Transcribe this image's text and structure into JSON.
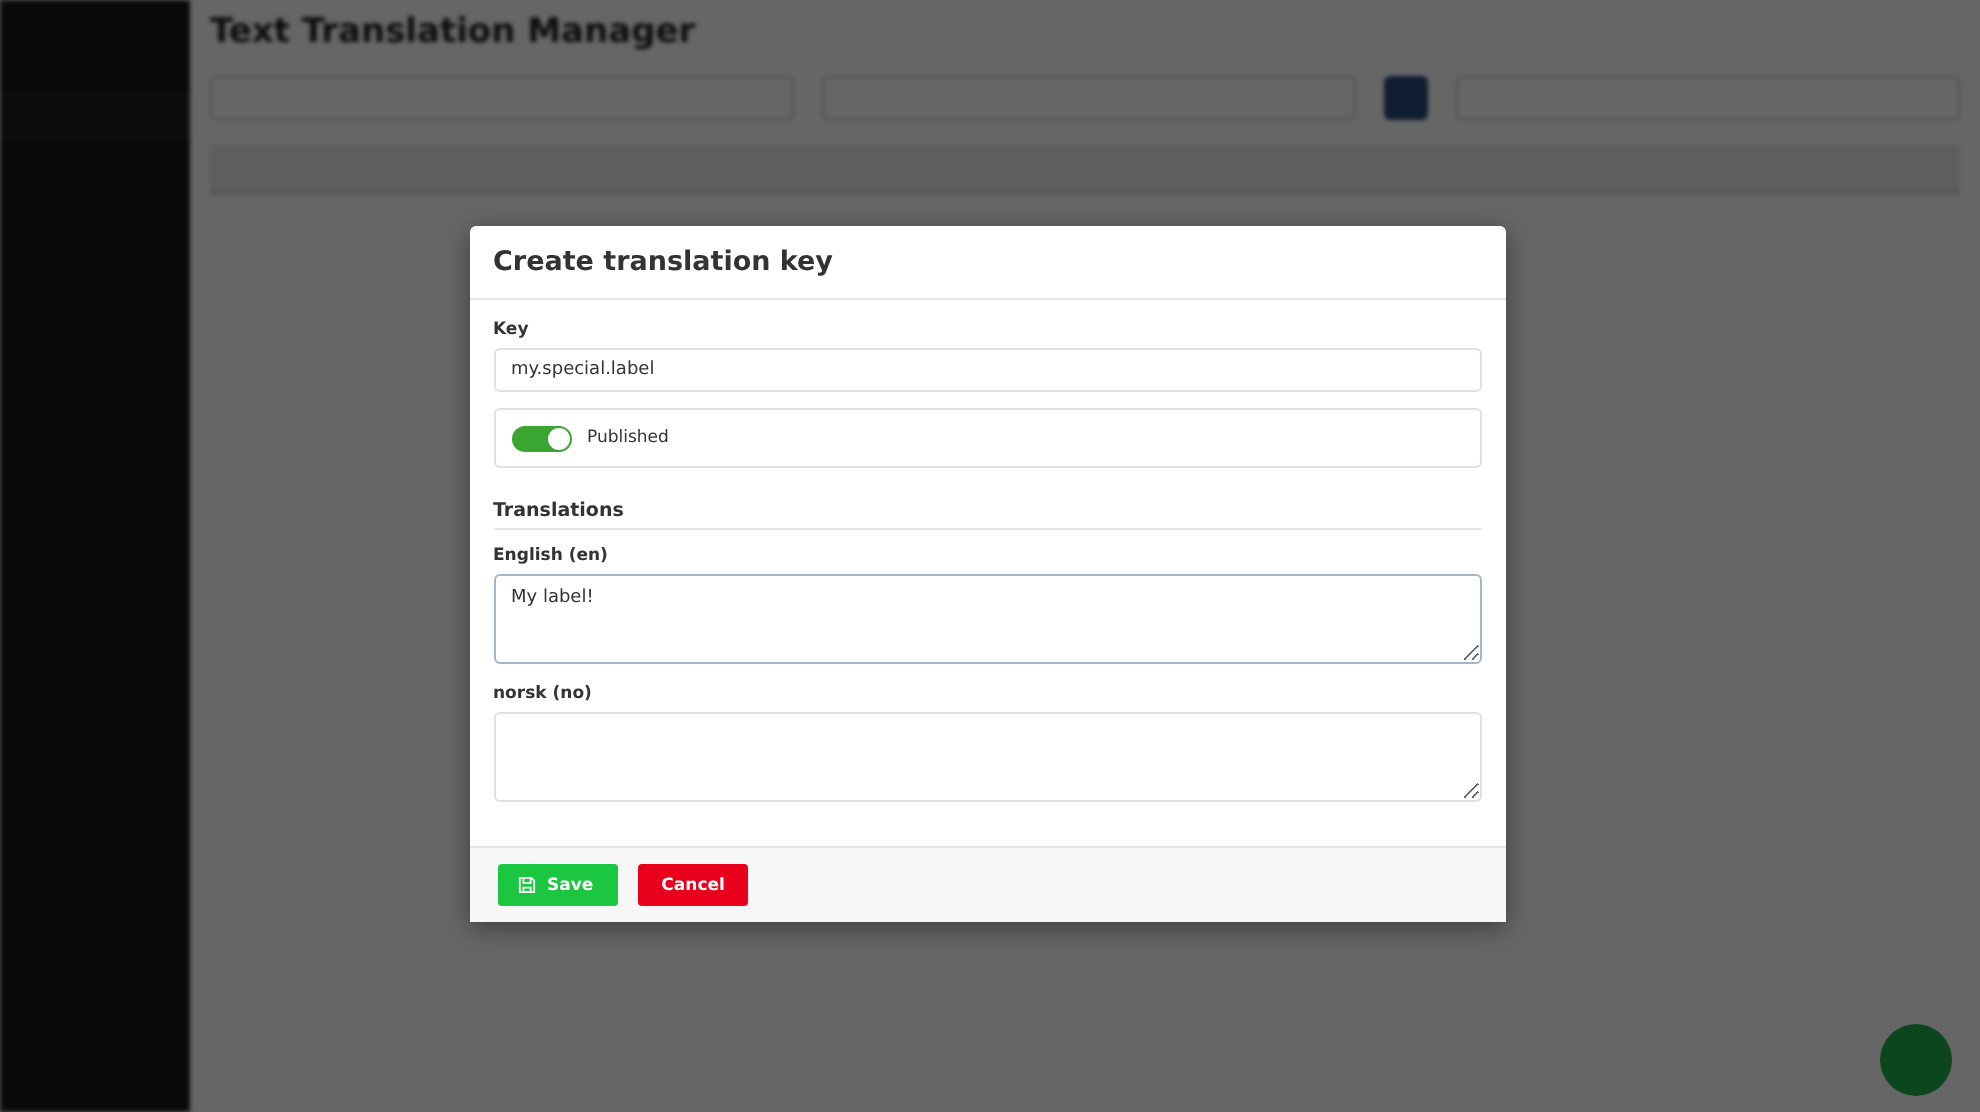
{
  "page": {
    "title": "Text Translation Manager"
  },
  "dialog": {
    "title": "Create translation key",
    "key": {
      "label": "Key",
      "value": "my.special.label"
    },
    "published": {
      "label": "Published",
      "on": true
    },
    "translations": {
      "heading": "Translations",
      "fields": [
        {
          "label": "English (en)",
          "value": "My label!",
          "focused": true
        },
        {
          "label": "norsk (no)",
          "focused": false
        }
      ]
    },
    "buttons": [
      {
        "label": "Save",
        "kind": "primary"
      },
      {
        "label": "Cancel",
        "kind": "danger"
      }
    ]
  }
}
